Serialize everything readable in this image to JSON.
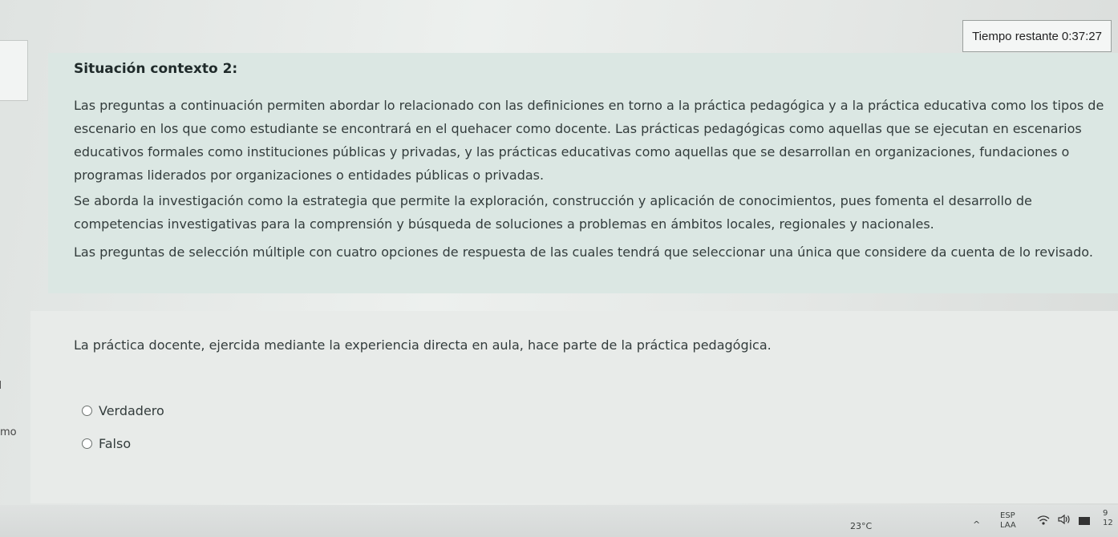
{
  "timer": {
    "label": "Tiempo restante",
    "value": "0:37:27"
  },
  "context": {
    "title": "Situación contexto 2:",
    "paragraphs": [
      "Las preguntas a continuación permiten abordar lo relacionado con las definiciones en torno a la práctica pedagógica y a la práctica educativa como los tipos de escenario en los que como estudiante se encontrará en el quehacer como docente. Las prácticas pedagógicas como aquellas que se ejecutan en escenarios educativos formales como instituciones públicas y privadas,  y las prácticas educativas como aquellas que se desarrollan en organizaciones, fundaciones o programas liderados por organizaciones o entidades públicas o privadas.",
      "Se aborda la investigación como la estrategia que permite la exploración, construcción y aplicación de conocimientos, pues fomenta el desarrollo de competencias investigativas para la comprensión y búsqueda de soluciones a problemas en ámbitos locales, regionales y nacionales.",
      "Las preguntas de selección múltiple con cuatro opciones de respuesta de las cuales tendrá que seleccionar una única que considere da cuenta de lo revisado."
    ]
  },
  "question": {
    "text": "La práctica docente, ejercida mediante la experiencia directa en aula, hace parte de la práctica pedagógica.",
    "options": [
      "Verdadero",
      "Falso"
    ]
  },
  "left_fragment": "mo",
  "taskbar": {
    "weather": "23°C",
    "tray_arrow": "^",
    "language": "ESP",
    "language_sub": "LAA",
    "clock_top": "9",
    "clock_bottom": "12"
  }
}
